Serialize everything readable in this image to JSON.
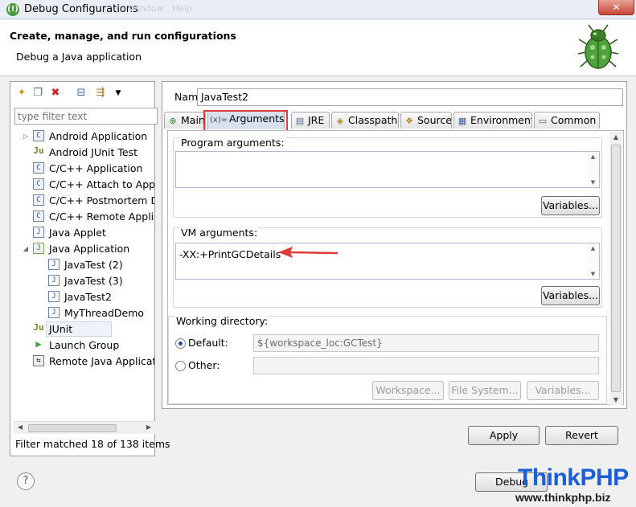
{
  "window": {
    "title": "Debug Configurations",
    "close_glyph": "✕",
    "ghost_menu": [
      "Window",
      "Help"
    ]
  },
  "header": {
    "title": "Create, manage, and run configurations",
    "subtitle": "Debug a Java application"
  },
  "toolbar": {
    "icons": [
      "new-config-icon",
      "duplicate-icon",
      "delete-icon",
      "collapse-all-icon",
      "filter-icon",
      "view-menu-icon"
    ],
    "delete_color": "#d42020"
  },
  "filter": {
    "placeholder": "type filter text"
  },
  "tree": {
    "items": [
      {
        "label": "Android Application",
        "icon": "C",
        "expander": "▷"
      },
      {
        "label": "Android JUnit Test",
        "icon": "Ju"
      },
      {
        "label": "C/C++ Application",
        "icon": "C"
      },
      {
        "label": "C/C++ Attach to Application",
        "icon": "C"
      },
      {
        "label": "C/C++ Postmortem Debugger",
        "icon": "C"
      },
      {
        "label": "C/C++ Remote Application",
        "icon": "C"
      },
      {
        "label": "Java Applet",
        "icon": "J"
      },
      {
        "label": "Java Application",
        "icon": "J",
        "expander": "◢"
      },
      {
        "label": "JavaTest (2)",
        "icon": "J"
      },
      {
        "label": "JavaTest (3)",
        "icon": "J"
      },
      {
        "label": "JavaTest2",
        "icon": "J"
      },
      {
        "label": "MyThreadDemo",
        "icon": "J"
      },
      {
        "label": "JUnit",
        "icon": "Ju"
      },
      {
        "label": "Launch Group",
        "icon": "▶"
      },
      {
        "label": "Remote Java Application",
        "icon": "⇆"
      }
    ],
    "scroll_left": "◀",
    "scroll_right": "▶"
  },
  "filter_status": "Filter matched 18 of 138 items",
  "config": {
    "name_label": "Name:",
    "name_value": "JavaTest2"
  },
  "tabs": [
    {
      "label": "Main",
      "icon": "⊕"
    },
    {
      "label": "Arguments",
      "icon": "(x)="
    },
    {
      "label": "JRE",
      "icon": "▤"
    },
    {
      "label": "Classpath",
      "icon": "◈"
    },
    {
      "label": "Source",
      "icon": "❖"
    },
    {
      "label": "Environment",
      "icon": "▦"
    },
    {
      "label": "Common",
      "icon": "▭"
    }
  ],
  "arguments": {
    "program_label": "Program arguments:",
    "program_value": "",
    "program_variables": "Variables...",
    "vm_label": "VM arguments:",
    "vm_value": "-XX:+PrintGCDetails",
    "vm_variables": "Variables...",
    "workdir_label": "Working directory:",
    "default_label": "Default:",
    "default_value": "${workspace_loc:GCTest}",
    "other_label": "Other:",
    "other_value": "",
    "workspace_btn": "Workspace...",
    "filesystem_btn": "File System...",
    "variables_btn": "Variables..."
  },
  "actions": {
    "apply": "Apply",
    "revert": "Revert",
    "debug": "Debug",
    "help_glyph": "?"
  },
  "watermark": {
    "brand": "ThinkPHP",
    "url": "www.thinkphp.biz"
  },
  "annotation_color": "#e03a3a"
}
